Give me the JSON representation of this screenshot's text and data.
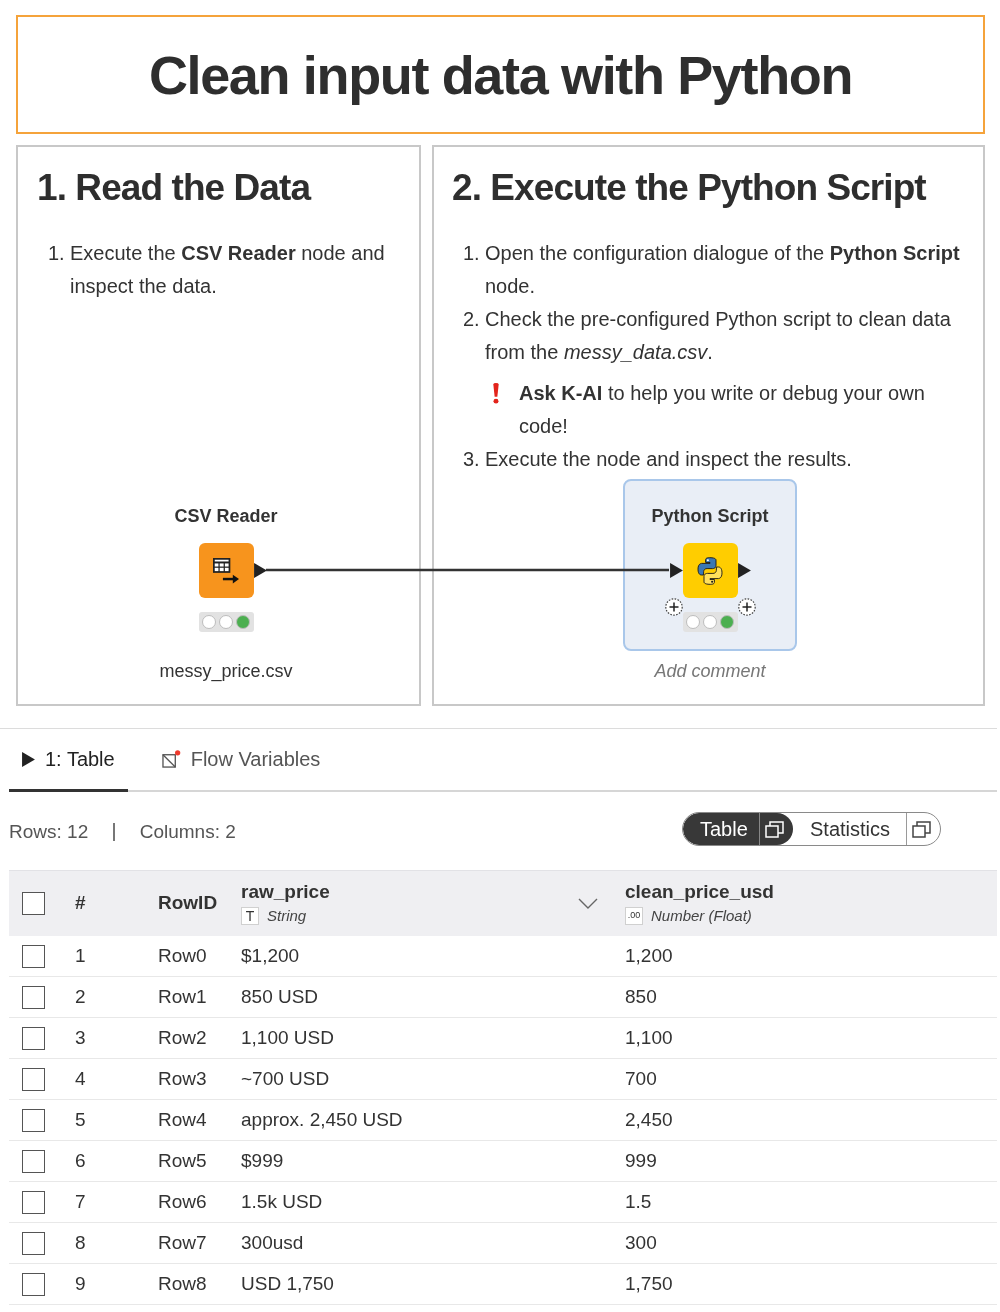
{
  "title": "Clean input data with Python",
  "panels": [
    {
      "heading": "1. Read the Data",
      "steps": [
        {
          "number": "1.",
          "text": "Execute the **CSV Reader** node and inspect the data."
        }
      ]
    },
    {
      "heading": "2. Execute the Python Script",
      "steps": [
        {
          "number": "1.",
          "text": "Open the configuration dialogue of the **Python Script** node."
        },
        {
          "number": "2.",
          "text": "Check the pre-configured Python script to clean data from the *messy_data.csv*.",
          "note": "**Ask K-AI** to help you write or debug your own code!"
        },
        {
          "number": "3.",
          "text": "Execute the node and inspect the results."
        }
      ]
    }
  ],
  "workflow": {
    "nodes": [
      {
        "kind": "reader",
        "name": "CSV Reader",
        "executed": true,
        "selected": false,
        "comment": "messy_price.csv"
      },
      {
        "kind": "script",
        "name": "Python Script",
        "executed": true,
        "selected": true,
        "comment_placeholder": "Add comment"
      }
    ]
  },
  "output": {
    "tabs": [
      {
        "kind": "table",
        "label": "1: Table",
        "selected": true
      },
      {
        "kind": "variables",
        "label": "Flow Variables",
        "selected": false
      }
    ],
    "rows_info": "Rows: 12",
    "columns_info": "Columns: 2",
    "view_toggle": [
      {
        "label": "Table",
        "selected": true
      },
      {
        "label": "Statistics",
        "selected": false
      }
    ],
    "table": {
      "header_checked": false,
      "index_label": "#",
      "rowid_label": "RowID",
      "columns": [
        {
          "name": "raw_price",
          "type_badge": "T",
          "type": "String",
          "menu_shown": true
        },
        {
          "name": "clean_price_usd",
          "type_badge": ".00",
          "type": "Number (Float)",
          "menu_shown": false
        }
      ],
      "rows": [
        {
          "index": "1",
          "row_id": "Row0",
          "checked": false,
          "values": [
            "$1,200",
            "1,200"
          ]
        },
        {
          "index": "2",
          "row_id": "Row1",
          "checked": false,
          "values": [
            "850 USD",
            "850"
          ]
        },
        {
          "index": "3",
          "row_id": "Row2",
          "checked": false,
          "values": [
            "1,100 USD",
            "1,100"
          ]
        },
        {
          "index": "4",
          "row_id": "Row3",
          "checked": false,
          "values": [
            "~700 USD",
            "700"
          ]
        },
        {
          "index": "5",
          "row_id": "Row4",
          "checked": false,
          "values": [
            "approx. 2,450 USD",
            "2,450"
          ]
        },
        {
          "index": "6",
          "row_id": "Row5",
          "checked": false,
          "values": [
            "$999",
            "999"
          ]
        },
        {
          "index": "7",
          "row_id": "Row6",
          "checked": false,
          "values": [
            "1.5k USD",
            "1.5"
          ]
        },
        {
          "index": "8",
          "row_id": "Row7",
          "checked": false,
          "values": [
            "300usd",
            "300"
          ]
        },
        {
          "index": "9",
          "row_id": "Row8",
          "checked": false,
          "values": [
            "USD 1,750",
            "1,750"
          ]
        }
      ]
    }
  }
}
